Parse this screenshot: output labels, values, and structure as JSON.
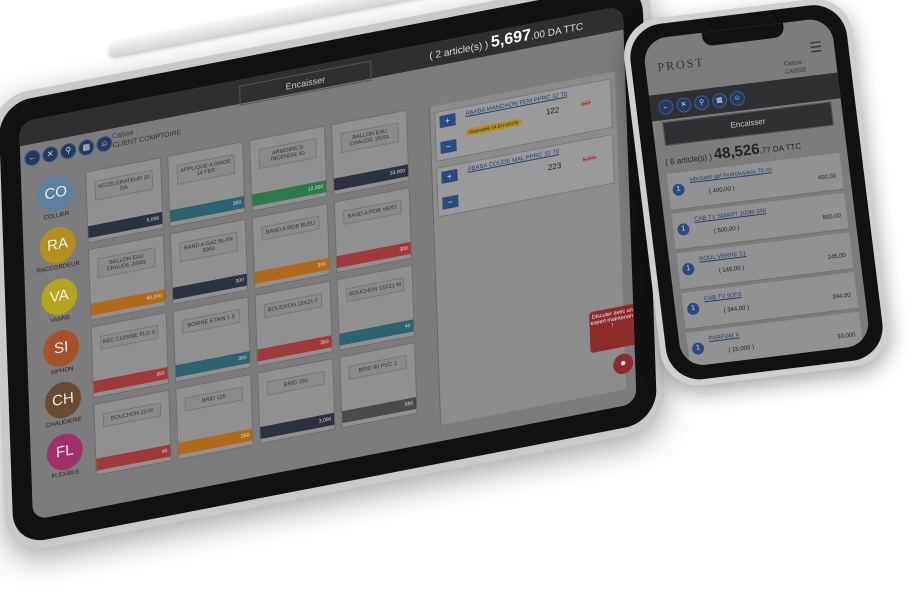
{
  "tablet": {
    "header": {
      "encaisser_label": "Encaisser",
      "total_prefix": "( 2 article(s) )",
      "total_amount": "5,697",
      "total_decimals": ".00",
      "total_currency": "DA TTC"
    },
    "toolbar": {
      "caisse_label": "Caisse :",
      "client_label": "CLIENT COMPTOIRE"
    },
    "categories": [
      {
        "abbr": "CO",
        "label": "COLLIER",
        "color": "#5d7fa0"
      },
      {
        "abbr": "RA",
        "label": "RACCORDEUR",
        "color": "#b38f1e"
      },
      {
        "abbr": "VA",
        "label": "VANNE",
        "color": "#b3a51e"
      },
      {
        "abbr": "SI",
        "label": "SIPHON",
        "color": "#a8502a"
      },
      {
        "abbr": "CH",
        "label": "CHAUDIERE",
        "color": "#6b4b2f"
      },
      {
        "abbr": "FL",
        "label": "FLEXIBLE",
        "color": "#a0306a"
      }
    ],
    "products": [
      {
        "name": "ACCELERATEUR 20 DA",
        "price": "5,000",
        "color": "#2a3140"
      },
      {
        "name": "APPLIQUE A DIAGE 14 FER",
        "price": "350",
        "color": "#2d6270"
      },
      {
        "name": "ARMOIRE D INCENDIE 40",
        "price": "12,000",
        "color": "#2c7a4a"
      },
      {
        "name": "BALLON EAU CHAUDE 1500L",
        "price": "33,000",
        "color": "#2a3140"
      },
      {
        "name": "BALLON EAU CHAUDE 2000L",
        "price": "40,000",
        "color": "#b06a1a"
      },
      {
        "name": "BAND A GAZ BLAN 2000",
        "price": "300",
        "color": "#2a3140"
      },
      {
        "name": "BAND A ROB BLEU",
        "price": "300",
        "color": "#b06a1a"
      },
      {
        "name": "BAND A ROB VERT",
        "price": "300",
        "color": "#a03a3a"
      },
      {
        "name": "BEC CUISINE FLO S",
        "price": "350",
        "color": "#a03a3a"
      },
      {
        "name": "BOBINE ETAIN 1.5",
        "price": "350",
        "color": "#2d6270"
      },
      {
        "name": "BOUCHON 15X21 F",
        "price": "350",
        "color": "#a03a3a"
      },
      {
        "name": "BOUCHON 15X21 M",
        "price": "40",
        "color": "#2d6270"
      },
      {
        "name": "BOUCHON 20 M",
        "price": "45",
        "color": "#a03a3a"
      },
      {
        "name": "BRID 125",
        "price": "250",
        "color": "#b06a1a"
      },
      {
        "name": "BRID 150",
        "price": "3,000",
        "color": "#2a3140"
      },
      {
        "name": "BRID 90 PVC 1",
        "price": "550",
        "color": "#4a4a4a"
      }
    ],
    "cart": [
      {
        "name": "ABABA MANCHON FEM PPRC 32 70",
        "badge": "Disponible 14 EN UNITE",
        "price": "122",
        "old": "122"
      },
      {
        "name": "ABABA COUDE MAL PPRC 32 70",
        "badge": "",
        "price": "223",
        "old": "5.5%"
      }
    ],
    "chat": {
      "text": "Discuter avec un expert maintenant !",
      "icon": "chat-bubble-icon"
    }
  },
  "phone": {
    "logo": "PROST",
    "caisse_label": "Caisse :",
    "caisse_value": "CAISSE",
    "encaisser_label": "Encaisser",
    "total_prefix": "( 6 article(s) )",
    "total_amount": "48,526",
    "total_decimals": ".77",
    "total_currency": "DA TTC",
    "items": [
      {
        "name": "lubrisant gel hydrotuyaux 70 ml",
        "qty": "( 400,00 )",
        "price": "400,00"
      },
      {
        "name": "CAB TV SMART 100M SNI",
        "qty": "( 500,00 )",
        "price": "500,00"
      },
      {
        "name": "ROUL VERRE 51",
        "qty": "( 145,00 )",
        "price": "145,00"
      },
      {
        "name": "CAB TV 50FS",
        "qty": "( 344,00 )",
        "price": "344,00"
      },
      {
        "name": "PARFUM X",
        "qty": "( 15,000 )",
        "price": "30,000"
      }
    ]
  }
}
